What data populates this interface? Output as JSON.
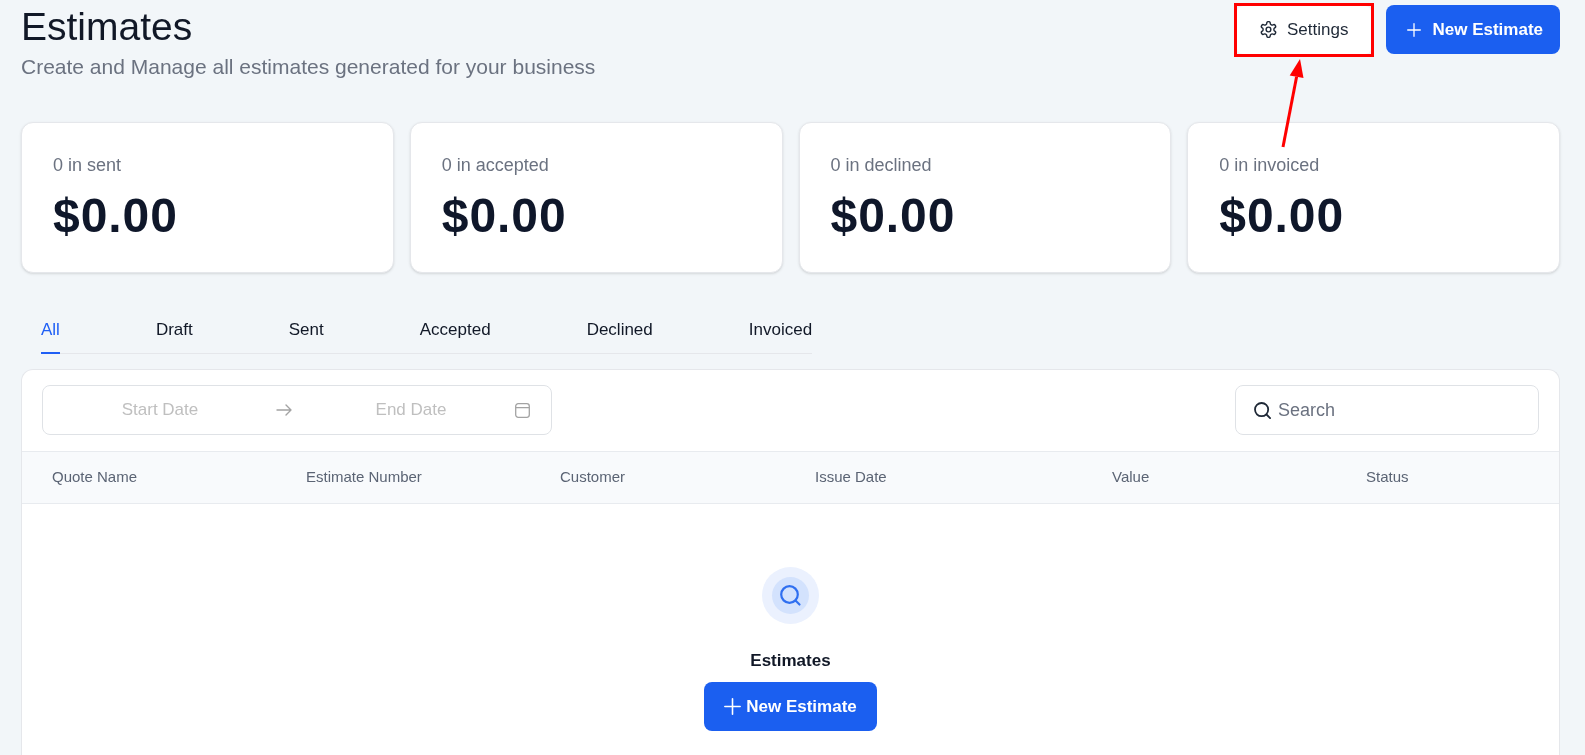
{
  "header": {
    "title": "Estimates",
    "subtitle": "Create and Manage all estimates generated for your business"
  },
  "settings_button": {
    "label": "Settings",
    "highlighted": true
  },
  "new_estimate_button": {
    "label": "New Estimate"
  },
  "stats": [
    {
      "label": "0 in sent",
      "value": "$0.00"
    },
    {
      "label": "0 in accepted",
      "value": "$0.00"
    },
    {
      "label": "0 in declined",
      "value": "$0.00"
    },
    {
      "label": "0 in invoiced",
      "value": "$0.00"
    }
  ],
  "tabs": [
    {
      "label": "All",
      "selected": true
    },
    {
      "label": "Draft",
      "selected": false
    },
    {
      "label": "Sent",
      "selected": false
    },
    {
      "label": "Accepted",
      "selected": false
    },
    {
      "label": "Declined",
      "selected": false
    },
    {
      "label": "Invoiced",
      "selected": false
    }
  ],
  "filters": {
    "start_date": {
      "placeholder": "Start Date"
    },
    "end_date": {
      "placeholder": "End Date"
    },
    "search": {
      "placeholder": "Search"
    }
  },
  "table": {
    "columns": [
      "Quote Name",
      "Estimate Number",
      "Customer",
      "Issue Date",
      "Value",
      "Status"
    ]
  },
  "empty_state": {
    "title": "Estimates",
    "button": {
      "label": "New Estimate"
    }
  }
}
